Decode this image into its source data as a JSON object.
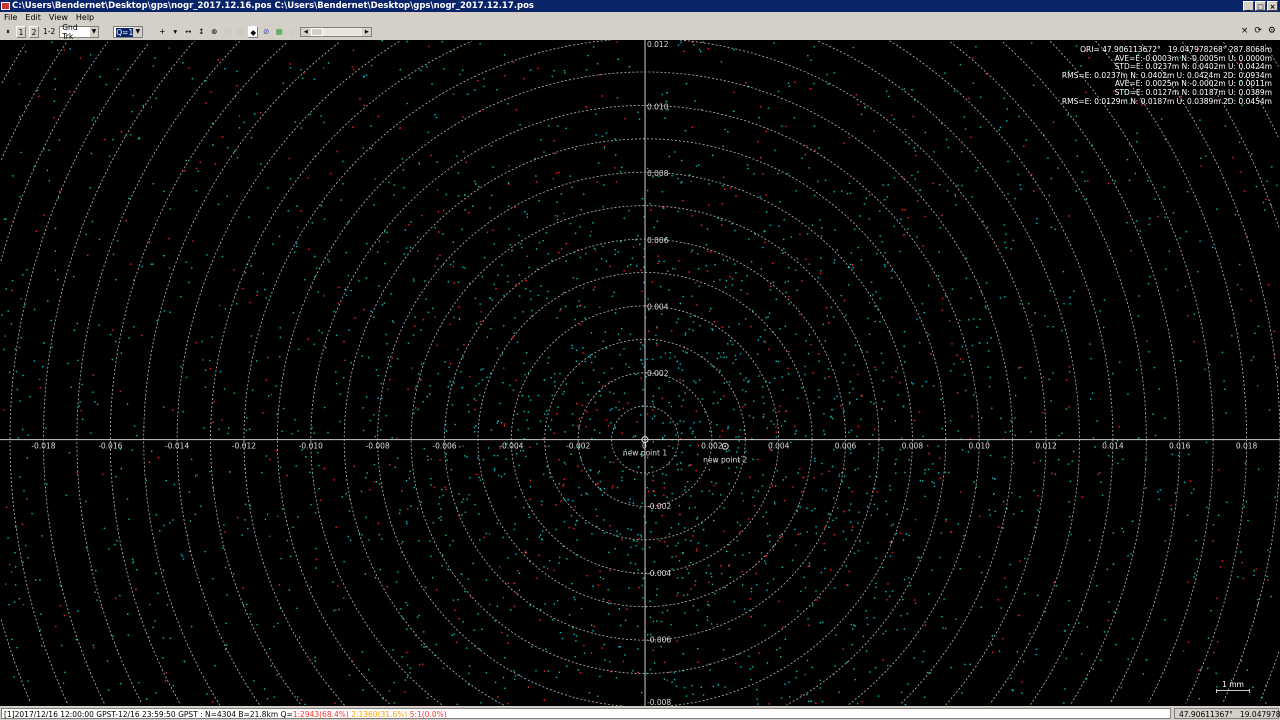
{
  "window": {
    "title": "C:\\Users\\Bendernet\\Desktop\\gps\\nogr_2017.12.16.pos C:\\Users\\Bendernet\\Desktop\\gps\\nogr_2017.12.17.pos"
  },
  "menu": [
    "File",
    "Edit",
    "View",
    "Help"
  ],
  "toolbar": {
    "btn1": "1",
    "btn2": "2",
    "btn12": "1-2",
    "plot_type": "Gnd Trk",
    "quality": "Q=1"
  },
  "stats": {
    "ori": "ORI= 47.906113672°   19.047978268° 287.8068m",
    "ave1": "AVE=E:-0.0003m N:-0.0005m U: 0.0000m",
    "std1": "STD=E: 0.0237m N: 0.0402m U: 0.0424m",
    "rms1": "RMS=E: 0.0237m N: 0.0402m U: 0.0424m 2D: 0.0934m",
    "ave2": "AVE=E: 0.0025m N:-0.0002m U: 0.0011m",
    "std2": "STD=E: 0.0127m N: 0.0187m U: 0.0389m",
    "rms2": "RMS=E: 0.0129m N: 0.0187m U: 0.0389m 2D: 0.0454m"
  },
  "markers": [
    {
      "label": "new point 1",
      "e": 0.0,
      "n": 0.0
    },
    {
      "label": "new point 2",
      "e": 0.0024,
      "n": -0.0002
    }
  ],
  "scale_label": "1 mm",
  "status": {
    "main": "[1]2017/12/16 12:00:00 GPST-12/16 23:59:50 GPST : N=4304 B=21.8km Q=",
    "q1": "1:2943(68.4%)",
    "q2": "2:1360(31.6%)",
    "q5": "5:1(0.0%)",
    "q1_color": "#ff3030",
    "q2_color": "#ffa000",
    "q5_color": "#ff3030",
    "coords": "47.90611367°   19.04797832°"
  },
  "chart_data": {
    "type": "scatter",
    "xlim": [
      -0.0193,
      0.019
    ],
    "ylim": [
      -0.008,
      0.012
    ],
    "x_ticks": [
      "-0.018",
      "-0.016",
      "-0.014",
      "-0.012",
      "-0.010",
      "-0.008",
      "-0.006",
      "-0.004",
      "-0.002",
      "0",
      "0.002",
      "0.004",
      "0.006",
      "0.008",
      "0.010",
      "0.012",
      "0.014",
      "0.016",
      "0.018"
    ],
    "y_ticks": [
      "-0.008",
      "-0.006",
      "-0.004",
      "-0.002",
      "0.002",
      "0.004",
      "0.006",
      "0.008",
      "0.010",
      "0.012"
    ],
    "grid": "concentric circles every 0.001",
    "series": [
      {
        "color": "#00c0c0"
      },
      {
        "color": "#ff2020"
      }
    ],
    "background": "#000000"
  }
}
